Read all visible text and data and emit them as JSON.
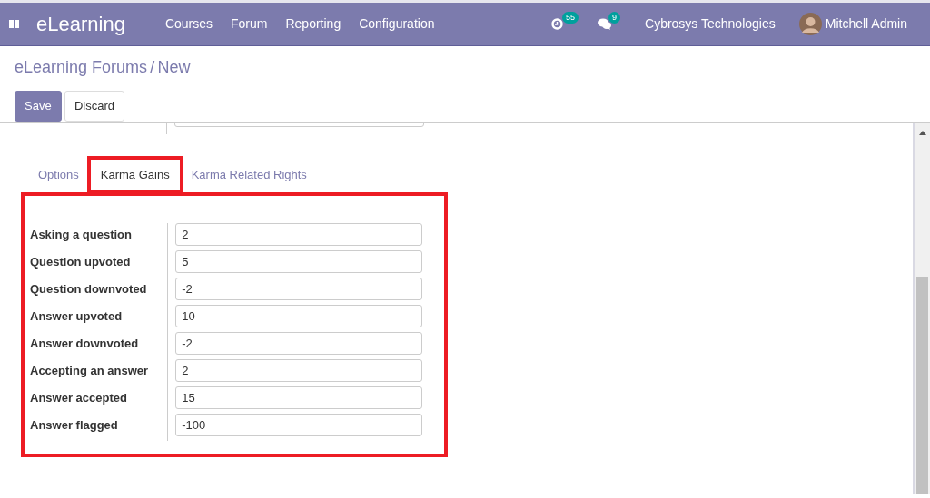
{
  "navbar": {
    "app_name": "eLearning",
    "menu": [
      "Courses",
      "Forum",
      "Reporting",
      "Configuration"
    ],
    "activity_count": "55",
    "message_count": "9",
    "company": "Cybrosys Technologies",
    "user": "Mitchell Admin"
  },
  "breadcrumb": {
    "parent": "eLearning Forums",
    "separator": "/",
    "current": "New"
  },
  "buttons": [
    {
      "label": "Save",
      "kind": "primary"
    },
    {
      "label": "Discard",
      "kind": "secondary"
    }
  ],
  "tabs": [
    {
      "label": "Options",
      "selected": false,
      "highlighted": false
    },
    {
      "label": "Karma Gains",
      "selected": true,
      "highlighted": true
    },
    {
      "label": "Karma Related Rights",
      "selected": false,
      "highlighted": false
    }
  ],
  "fields": [
    {
      "label": "Asking a question",
      "value": "2"
    },
    {
      "label": "Question upvoted",
      "value": "5"
    },
    {
      "label": "Question downvoted",
      "value": "-2"
    },
    {
      "label": "Answer upvoted",
      "value": "10"
    },
    {
      "label": "Answer downvoted",
      "value": "-2"
    },
    {
      "label": "Accepting an answer",
      "value": "2"
    },
    {
      "label": "Answer accepted",
      "value": "15"
    },
    {
      "label": "Answer flagged",
      "value": "-100"
    }
  ]
}
